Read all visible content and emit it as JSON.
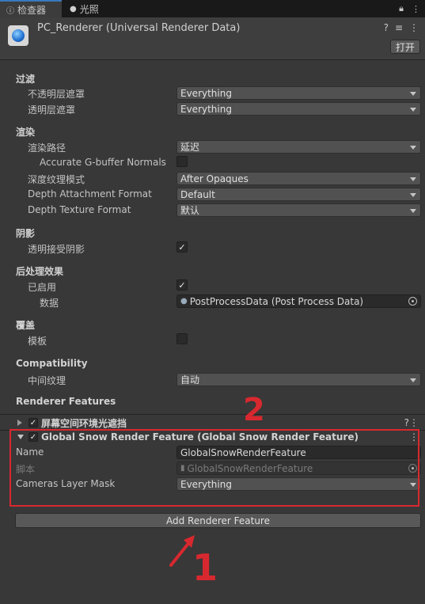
{
  "tabs": [
    {
      "label": "检查器"
    },
    {
      "label": "光照"
    }
  ],
  "header": {
    "title": "PC_Renderer (Universal Renderer Data)",
    "open_label": "打开"
  },
  "sections": {
    "filter": "过滤",
    "render": "渲染",
    "shadow": "阴影",
    "post": "后处理效果",
    "overrides": "覆盖",
    "compat": "Compatibility",
    "features": "Renderer Features"
  },
  "fields": {
    "opaque_mask": {
      "label": "不透明层遮罩",
      "value": "Everything"
    },
    "transparent_mask": {
      "label": "透明层遮罩",
      "value": "Everything"
    },
    "render_path": {
      "label": "渲染路径",
      "value": "延迟"
    },
    "accurate_normals": {
      "label": "Accurate G-buffer Normals",
      "checked": false
    },
    "depth_texture_mode": {
      "label": "深度纹理模式",
      "value": "After Opaques"
    },
    "depth_attachment_format": {
      "label": "Depth Attachment Format",
      "value": "Default"
    },
    "depth_texture_format": {
      "label": "Depth Texture Format",
      "value": "默认"
    },
    "transparent_receive_shadows": {
      "label": "透明接受阴影",
      "checked": true
    },
    "post_enabled": {
      "label": "已启用",
      "checked": true
    },
    "post_data": {
      "label": "数据",
      "value": "PostProcessData (Post Process Data)"
    },
    "stencil": {
      "label": "模板",
      "checked": false
    },
    "intermediate_texture": {
      "label": "中间纹理",
      "value": "自动"
    }
  },
  "features": {
    "ssao": {
      "title": "屏幕空间环境光遮挡",
      "enabled": true
    },
    "snow": {
      "title": "Global Snow Render Feature (Global Snow Render Feature)",
      "enabled": true,
      "name_label": "Name",
      "name_value": "GlobalSnowRenderFeature",
      "script_label": "脚本",
      "script_value": "GlobalSnowRenderFeature",
      "mask_label": "Cameras Layer Mask",
      "mask_value": "Everything"
    },
    "add_label": "Add Renderer Feature"
  },
  "annotations": {
    "num1": "1",
    "num2": "2",
    "color": "#d8282f"
  }
}
